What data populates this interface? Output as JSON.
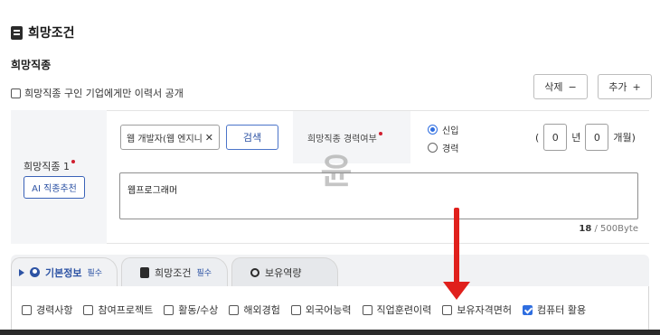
{
  "section": {
    "title": "희망조건"
  },
  "job": {
    "subtitle": "희망직종",
    "private_check_label": "희망직종 구인 기업에게만 이력서 공개",
    "delete_label": "삭제",
    "delete_sign": "−",
    "add_label": "추가",
    "add_sign": "+",
    "field_label": "희망직종 1",
    "ai_button_label": "AI 직종추천",
    "job_value": "웹 개발자(웹 엔지니",
    "search_label": "검색",
    "experience_label": "희망직종 경력여부",
    "radio_new": "신입",
    "radio_career": "경력",
    "period_open": "(",
    "years_value": "0",
    "years_unit": "년",
    "months_value": "0",
    "months_unit": "개월)",
    "description": "웹프로그래머",
    "counter_current": "18",
    "counter_max": " / 500Byte",
    "watermark": "윤"
  },
  "tabs": [
    {
      "label": "기본정보",
      "required": "필수"
    },
    {
      "label": "희망조건",
      "required": "필수"
    },
    {
      "label": "보유역량"
    }
  ],
  "skill_checks": [
    {
      "label": "경력사항",
      "checked": false
    },
    {
      "label": "참여프로젝트",
      "checked": false
    },
    {
      "label": "활동/수상",
      "checked": false
    },
    {
      "label": "해외경험",
      "checked": false
    },
    {
      "label": "외국어능력",
      "checked": false
    },
    {
      "label": "직업훈련이력",
      "checked": false
    },
    {
      "label": "보유자격면허",
      "checked": false
    },
    {
      "label": "컴퓨터 활용",
      "checked": true
    }
  ],
  "colors": {
    "accent": "#2f6ee0",
    "required_dot": "#d01f2f",
    "annotation_arrow": "#e0201c"
  }
}
